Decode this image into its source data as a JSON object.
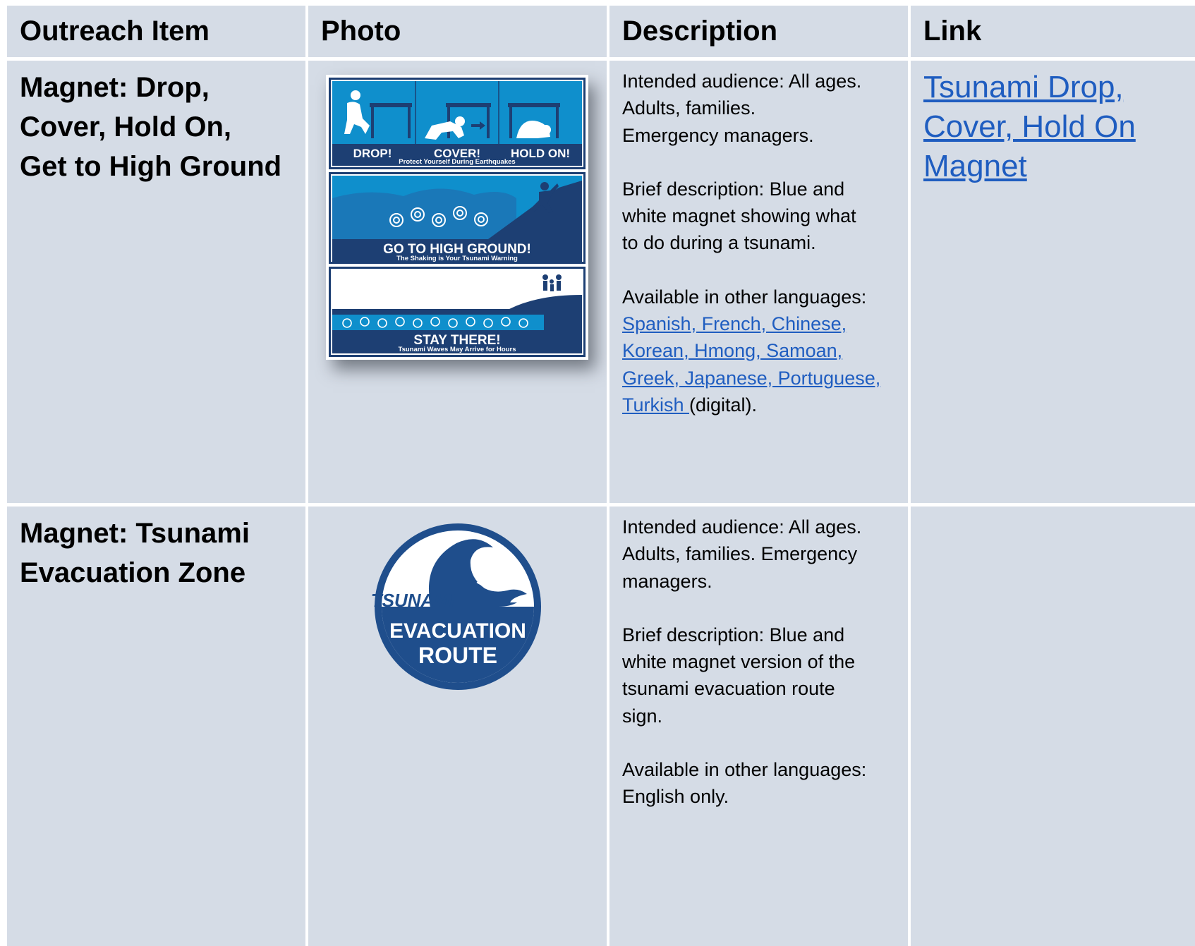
{
  "header": {
    "col1": "Outreach Item",
    "col2": "Photo",
    "col3": "Description",
    "col4": "Link"
  },
  "rows": [
    {
      "item": [
        "Magnet: Drop,",
        "Cover, Hold On,",
        "Get to High Ground"
      ],
      "photo": {
        "panel1": {
          "labels": [
            "DROP!",
            "COVER!",
            "HOLD ON!"
          ],
          "caption": "Protect Yourself During Earthquakes"
        },
        "panel2": {
          "title": "GO TO HIGH GROUND!",
          "caption": "The Shaking is Your Tsunami Warning"
        },
        "panel3": {
          "title": "STAY THERE!",
          "caption": "Tsunami Waves May Arrive for Hours"
        }
      },
      "description": {
        "audience_lines": [
          "Intended audience: All ages.",
          "Adults, families.",
          "Emergency managers."
        ],
        "brief_lines": [
          "Brief description: Blue and",
          "white magnet showing what",
          "to do during a tsunami."
        ],
        "languages_label": "Available in other languages:",
        "language_link_lines": [
          "Spanish, French, Chinese,",
          "Korean, Hmong, Samoan,",
          "Greek, Japanese, Portuguese,",
          "Turkish "
        ],
        "languages_suffix": "(digital)."
      },
      "link_lines": [
        "Tsunami Drop,",
        "Cover, Hold On",
        "Magnet"
      ]
    },
    {
      "item": [
        "Magnet: Tsunami",
        "Evacuation Zone"
      ],
      "photo": {
        "sign_lines": [
          "TSUNAMI",
          "EVACUATION",
          "ROUTE"
        ]
      },
      "description": {
        "audience_lines": [
          "Intended audience: All ages.",
          "Adults, families. Emergency",
          "managers."
        ],
        "brief_lines": [
          "Brief description: Blue and",
          "white magnet version of the",
          "tsunami evacuation route",
          "sign."
        ],
        "languages_lines": [
          "Available in other languages:",
          "English only."
        ]
      }
    }
  ],
  "colors": {
    "cell_bg": "#d5dce6",
    "link": "#1f5dc0",
    "magnet_blue": "#0f8fcc",
    "magnet_navy": "#1d3f73",
    "sign_blue": "#1f4e8c"
  }
}
